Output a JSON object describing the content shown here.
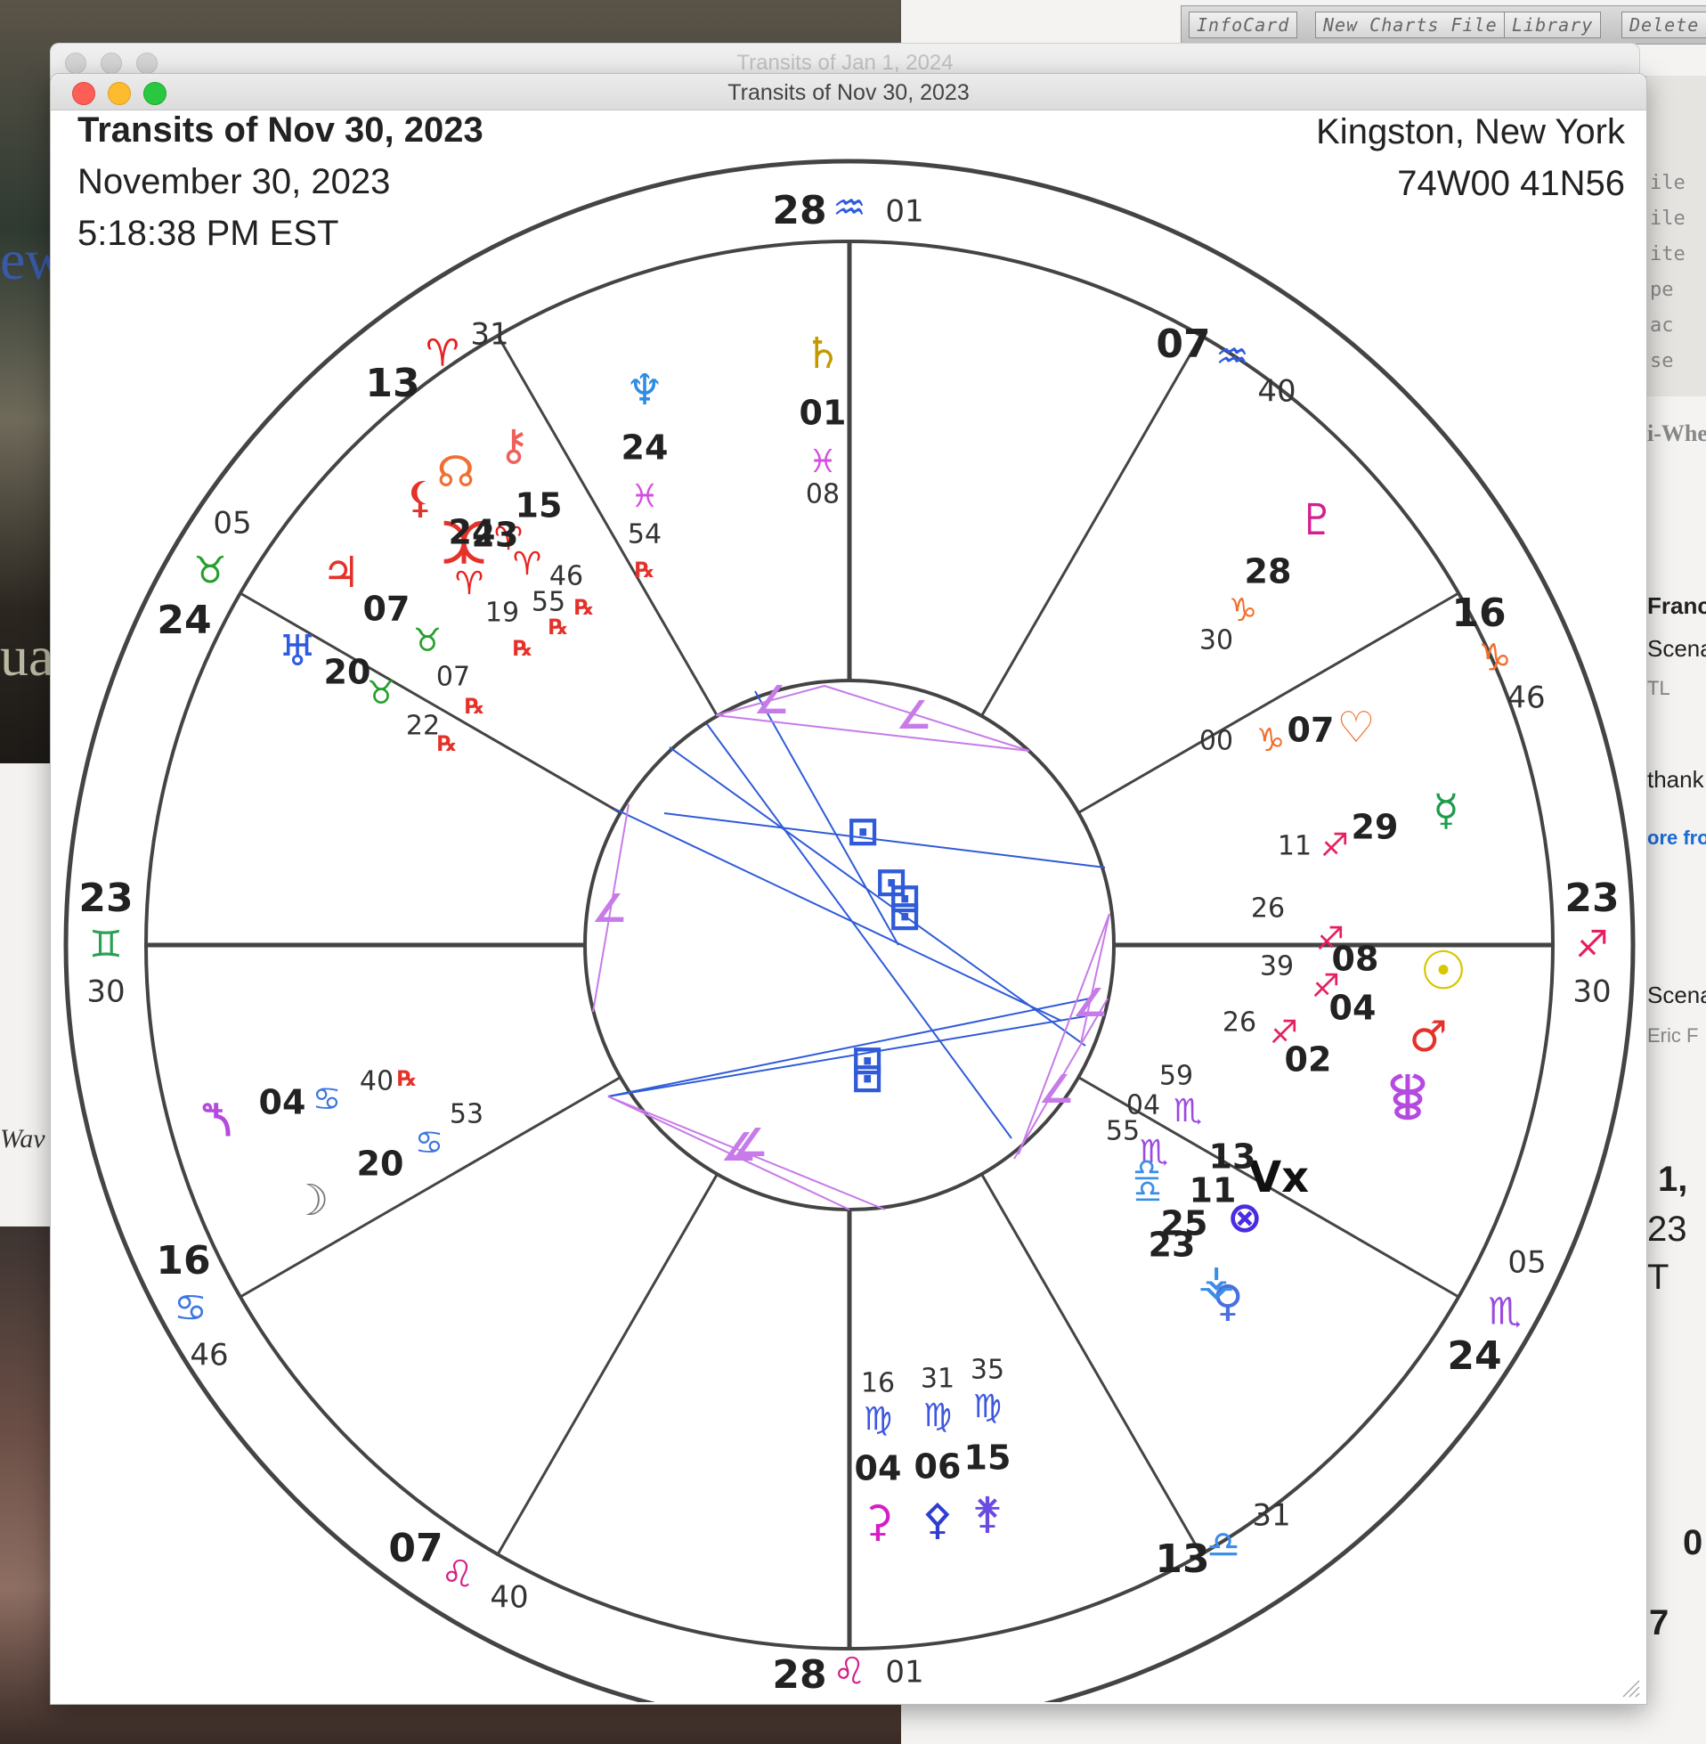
{
  "background": {
    "left_fragments": [
      "ew",
      "ua",
      "Wav"
    ],
    "right_app": {
      "toolbar": [
        "InfoCard",
        "New Charts File",
        "Library",
        "Delete"
      ],
      "side_labels": [
        "ile",
        "ile",
        "ite",
        "pe",
        "ac",
        "se"
      ],
      "wheel_label": "i-Whe",
      "fragments": [
        "Franc",
        "Scena",
        "TL",
        "thank",
        "ore from",
        "Scena",
        "Eric F",
        "1, ",
        "23",
        "T",
        "0",
        "7"
      ]
    }
  },
  "back_window": {
    "title": "Transits of Jan 1, 2024"
  },
  "window": {
    "title": "Transits of Nov 30, 2023"
  },
  "chart_info": {
    "title": "Transits of Nov 30, 2023",
    "date": "November 30, 2023",
    "time": "5:18:38 PM EST",
    "location": "Kingston, New York",
    "coordinates": "74W00 41N56"
  },
  "colors": {
    "outer_ring": "#444444",
    "aspect_square": "#2f5bd8",
    "aspect_semisextile": "#c77be8",
    "sign_aries": "#e8201f",
    "sign_taurus": "#25a02b",
    "sign_gemini": "#2aa055",
    "sign_cancer": "#3e76e0",
    "sign_leo": "#d61f86",
    "sign_virgo": "#3e57e0",
    "sign_libra": "#3a8de8",
    "sign_scorpio": "#9b4ae0",
    "sign_sagittarius": "#e6205e",
    "sign_capricorn": "#f07030",
    "sign_aquarius": "#2f5be0",
    "sign_pisces": "#d44ee0"
  },
  "house_cusps": [
    {
      "deg": "23",
      "sign": "♊",
      "sign_name": "Gemini",
      "min": "30"
    },
    {
      "deg": "16",
      "sign": "♋",
      "sign_name": "Cancer",
      "min": "46"
    },
    {
      "deg": "07",
      "sign": "♌",
      "sign_name": "Leo",
      "min": "40"
    },
    {
      "deg": "28",
      "sign": "♌",
      "sign_name": "Leo",
      "min": "01"
    },
    {
      "deg": "13",
      "sign": "♎",
      "sign_name": "Libra",
      "min": "31"
    },
    {
      "deg": "24",
      "sign": "♏",
      "sign_name": "Scorpio",
      "min": "05"
    },
    {
      "deg": "23",
      "sign": "♐",
      "sign_name": "Sagittarius",
      "min": "30"
    },
    {
      "deg": "16",
      "sign": "♑",
      "sign_name": "Capricorn",
      "min": "46"
    },
    {
      "deg": "07",
      "sign": "♒",
      "sign_name": "Aquarius",
      "min": "40"
    },
    {
      "deg": "28",
      "sign": "♒",
      "sign_name": "Aquarius",
      "min": "01"
    },
    {
      "deg": "13",
      "sign": "♈",
      "sign_name": "Aries",
      "min": "31"
    },
    {
      "deg": "24",
      "sign": "♉",
      "sign_name": "Taurus",
      "min": "05"
    }
  ],
  "planets": [
    {
      "name": "Sun",
      "glyph": "☉",
      "deg": "08",
      "sign": "♐",
      "min": "26",
      "retro": ""
    },
    {
      "name": "Moon",
      "glyph": "☽",
      "deg": "20",
      "sign": "♋",
      "min": "53",
      "retro": ""
    },
    {
      "name": "Mercury",
      "glyph": "☿",
      "deg": "29",
      "sign": "♐",
      "min": "11",
      "retro": ""
    },
    {
      "name": "Venus",
      "glyph": "♀",
      "deg": "23",
      "sign": "♎",
      "min": "",
      "retro": ""
    },
    {
      "name": "Mars",
      "glyph": "♂",
      "deg": "04",
      "sign": "♐",
      "min": "39",
      "retro": ""
    },
    {
      "name": "Jupiter",
      "glyph": "♃",
      "deg": "07",
      "sign": "♉",
      "min": "07",
      "retro": "℞"
    },
    {
      "name": "Saturn",
      "glyph": "♄",
      "deg": "01",
      "sign": "♓",
      "min": "08",
      "retro": ""
    },
    {
      "name": "Uranus",
      "glyph": "♅",
      "deg": "20",
      "sign": "♉",
      "min": "22",
      "retro": "℞"
    },
    {
      "name": "Neptune",
      "glyph": "♆",
      "deg": "24",
      "sign": "♓",
      "min": "54",
      "retro": "℞"
    },
    {
      "name": "Pluto",
      "glyph": "♇",
      "deg": "28",
      "sign": "♑",
      "min": "30",
      "retro": ""
    },
    {
      "name": "North Node",
      "glyph": "☊",
      "deg": "15",
      "sign": "♈",
      "min": "46",
      "retro": "℞"
    },
    {
      "name": "Chiron",
      "glyph": "⚷",
      "deg": "",
      "sign": "",
      "min": "",
      "retro": ""
    },
    {
      "name": "Lilith",
      "glyph": "⚸",
      "deg": "23",
      "sign": "♈",
      "min": "55",
      "retro": "℞"
    },
    {
      "name": "Vertex",
      "glyph": "Vx",
      "deg": "13",
      "sign": "♏",
      "min": "59",
      "retro": ""
    },
    {
      "name": "Part of Fortune",
      "glyph": "⊗",
      "deg": "11",
      "sign": "♏",
      "min": "04",
      "retro": ""
    },
    {
      "name": "Ceres",
      "glyph": "⚳",
      "deg": "04",
      "sign": "♍",
      "min": "16",
      "retro": ""
    },
    {
      "name": "Pallas",
      "glyph": "⚴",
      "deg": "06",
      "sign": "♍",
      "min": "31",
      "retro": ""
    },
    {
      "name": "Juno",
      "glyph": "⚵",
      "deg": "15",
      "sign": "♍",
      "min": "35",
      "retro": ""
    },
    {
      "name": "Vesta",
      "glyph": "⚶",
      "deg": "25",
      "sign": "♎",
      "min": "55",
      "retro": ""
    },
    {
      "name": "Eris",
      "glyph": "⯰",
      "deg": "24",
      "sign": "♈",
      "min": "19",
      "retro": "℞"
    },
    {
      "name": "Sedna",
      "glyph": "⯲",
      "deg": "04",
      "sign": "♋",
      "min": "40",
      "retro": "℞"
    },
    {
      "name": "Eros",
      "glyph": "♡",
      "deg": "07",
      "sign": "♑",
      "min": "00",
      "retro": ""
    },
    {
      "name": "Hygiea",
      "glyph": "⯚",
      "deg": "02",
      "sign": "♐",
      "min": "26",
      "retro": ""
    }
  ]
}
